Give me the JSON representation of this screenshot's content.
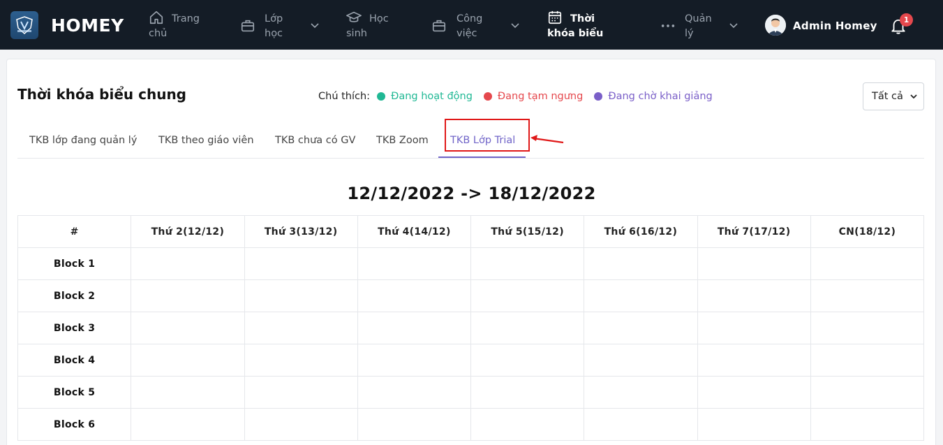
{
  "brand": "HOMEY",
  "nav": {
    "home": "Trang chủ",
    "classes": "Lớp học",
    "students": "Học sinh",
    "work": "Công việc",
    "schedule": "Thời khóa biểu",
    "manage": "Quản lý"
  },
  "user": {
    "name": "Admin Homey"
  },
  "notifications": {
    "count": "1"
  },
  "page": {
    "title": "Thời khóa biểu chung",
    "legend_label": "Chú thích:",
    "legend": [
      {
        "label": "Đang hoạt động",
        "color": "#20b894"
      },
      {
        "label": "Đang tạm ngưng",
        "color": "#e5484d"
      },
      {
        "label": "Đang chờ khai giảng",
        "color": "#7a5fc8"
      }
    ],
    "filter": {
      "selected": "Tất cả"
    }
  },
  "tabs": [
    {
      "label": "TKB lớp đang quản lý",
      "active": false
    },
    {
      "label": "TKB theo giáo viên",
      "active": false
    },
    {
      "label": "TKB chưa có GV",
      "active": false
    },
    {
      "label": "TKB Zoom",
      "active": false
    },
    {
      "label": "TKB Lớp Trial",
      "active": true
    }
  ],
  "week_range": "12/12/2022 -> 18/12/2022",
  "table": {
    "corner": "#",
    "days": [
      "Thứ 2(12/12)",
      "Thứ 3(13/12)",
      "Thứ 4(14/12)",
      "Thứ 5(15/12)",
      "Thứ 6(16/12)",
      "Thứ 7(17/12)",
      "CN(18/12)"
    ],
    "blocks": [
      "Block 1",
      "Block 2",
      "Block 3",
      "Block 4",
      "Block 5",
      "Block 6"
    ]
  },
  "colors": {
    "nav_bg": "#141c26",
    "accent": "#7064c8",
    "highlight": "#e01818"
  }
}
